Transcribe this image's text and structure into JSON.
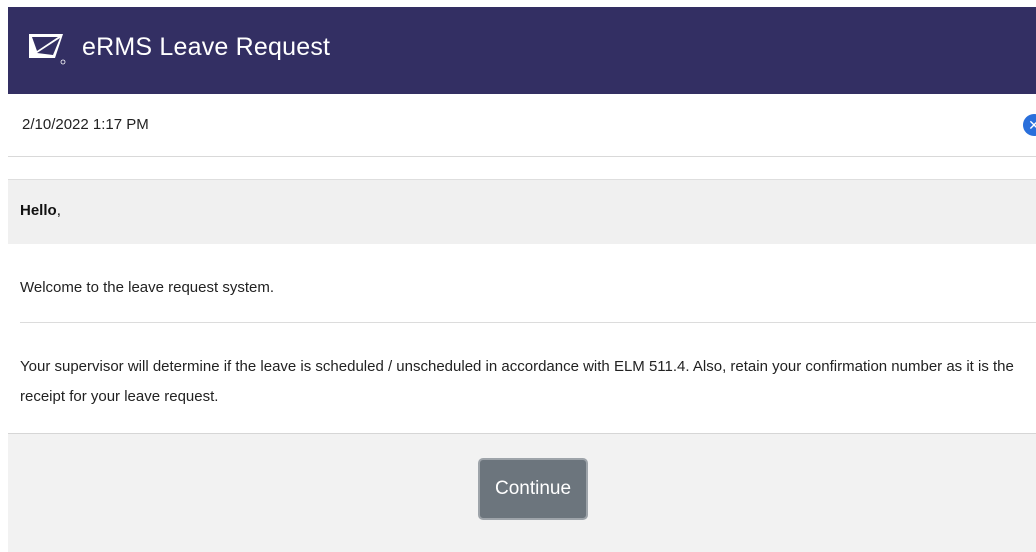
{
  "header": {
    "title": "eRMS Leave Request",
    "logo_icon": "usps-eagle-logo-icon"
  },
  "status": {
    "datetime": "2/10/2022 1:17 PM",
    "close_icon": "close-circle-icon"
  },
  "greeting": {
    "hello": "Hello",
    "punct": ","
  },
  "message": {
    "welcome": "Welcome to the leave request system.",
    "info": "Your supervisor will determine if the leave is scheduled / unscheduled in accordance with ELM 511.4. Also, retain your confirmation number as it is the receipt for your leave request."
  },
  "footer": {
    "continue_label": "Continue"
  },
  "colors": {
    "header_bg": "#332f63",
    "button_bg": "#6c757d",
    "close_icon": "#2a6fdb"
  }
}
